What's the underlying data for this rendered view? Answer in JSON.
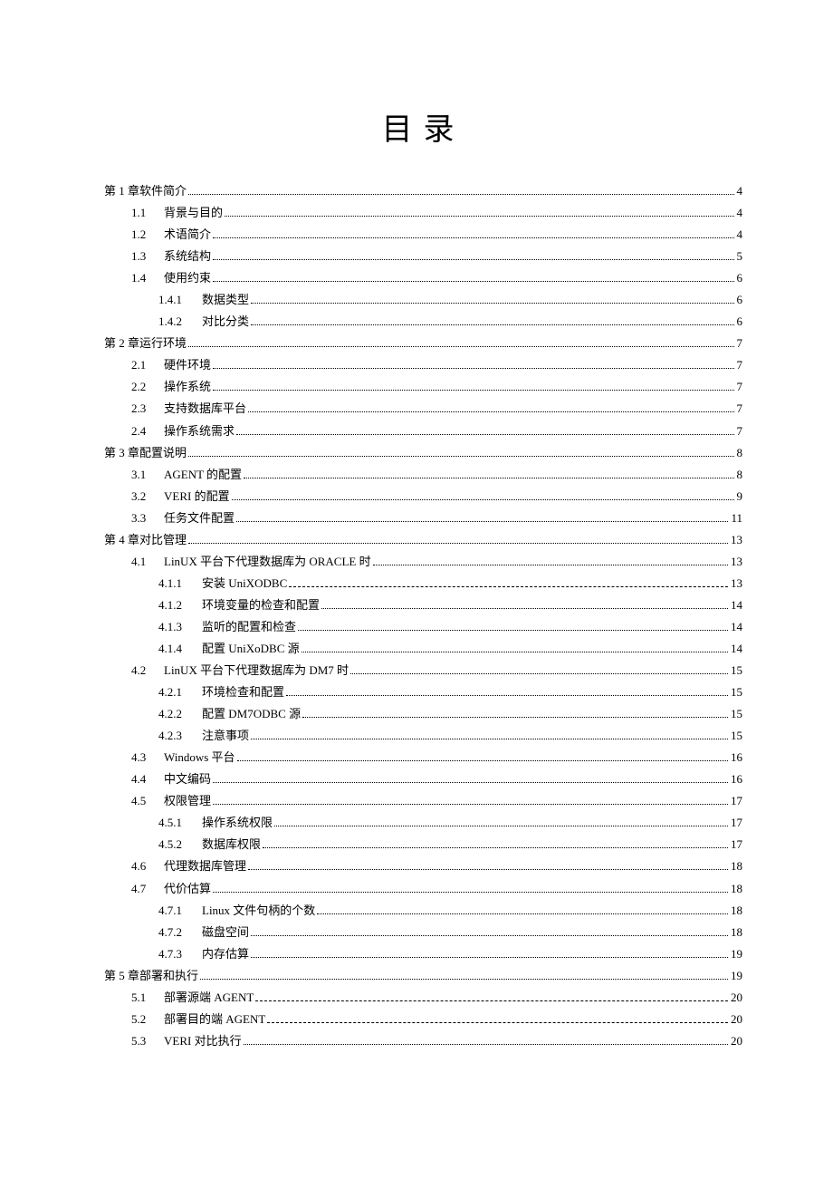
{
  "title": "目录",
  "entries": [
    {
      "level": 1,
      "num": "",
      "label": "第 1 章软件简介",
      "page": "4",
      "dash": false
    },
    {
      "level": 2,
      "num": "1.1",
      "label": "背景与目的",
      "page": "4",
      "dash": false
    },
    {
      "level": 2,
      "num": "1.2",
      "label": "术语简介",
      "page": "4",
      "dash": false
    },
    {
      "level": 2,
      "num": "1.3",
      "label": "系统结构",
      "page": "5",
      "dash": false
    },
    {
      "level": 2,
      "num": "1.4",
      "label": "使用约束",
      "page": "6",
      "dash": false
    },
    {
      "level": 3,
      "num": "1.4.1",
      "label": "数据类型",
      "page": "6",
      "dash": false
    },
    {
      "level": 3,
      "num": "1.4.2",
      "label": "对比分类",
      "page": "6",
      "dash": false
    },
    {
      "level": 1,
      "num": "",
      "label": "第 2 章运行环境",
      "page": "7",
      "dash": false
    },
    {
      "level": 2,
      "num": "2.1",
      "label": "硬件环境",
      "page": "7",
      "dash": false
    },
    {
      "level": 2,
      "num": "2.2",
      "label": "操作系统",
      "page": "7",
      "dash": false
    },
    {
      "level": 2,
      "num": "2.3",
      "label": "支持数据库平台",
      "page": "7",
      "dash": false
    },
    {
      "level": 2,
      "num": "2.4",
      "label": "操作系统需求",
      "page": "7",
      "dash": false
    },
    {
      "level": 1,
      "num": "",
      "label": "第 3 章配置说明",
      "page": "8",
      "dash": false
    },
    {
      "level": 2,
      "num": "3.1",
      "label": "AGENT 的配置",
      "page": "8",
      "dash": false
    },
    {
      "level": 2,
      "num": "3.2",
      "label": "VERI 的配置",
      "page": "9",
      "dash": false
    },
    {
      "level": 2,
      "num": "3.3",
      "label": "任务文件配置",
      "page": "11",
      "dash": false
    },
    {
      "level": 1,
      "num": "",
      "label": "第 4 章对比管理",
      "page": "13",
      "dash": false
    },
    {
      "level": 2,
      "num": "4.1",
      "label": "LinUX 平台下代理数据库为 ORACLE 时",
      "page": "13",
      "dash": false
    },
    {
      "level": 3,
      "num": "4.1.1",
      "label": "安装 UniXODBC",
      "page": "13",
      "dash": true
    },
    {
      "level": 3,
      "num": "4.1.2",
      "label": "环境变量的检查和配置",
      "page": "14",
      "dash": false
    },
    {
      "level": 3,
      "num": "4.1.3",
      "label": "监听的配置和检查",
      "page": "14",
      "dash": false
    },
    {
      "level": 3,
      "num": "4.1.4",
      "label": "配置 UniXoDBC 源",
      "page": "14",
      "dash": false
    },
    {
      "level": 2,
      "num": "4.2",
      "label": "LinUX 平台下代理数据库为 DM7 时",
      "page": "15",
      "dash": false
    },
    {
      "level": 3,
      "num": "4.2.1",
      "label": "环境检查和配置",
      "page": "15",
      "dash": false
    },
    {
      "level": 3,
      "num": "4.2.2",
      "label": "配置 DM7ODBC 源",
      "page": "15",
      "dash": false
    },
    {
      "level": 3,
      "num": "4.2.3",
      "label": "注意事项",
      "page": "15",
      "dash": false
    },
    {
      "level": 2,
      "num": "4.3",
      "label": "Windows 平台",
      "page": "16",
      "dash": false
    },
    {
      "level": 2,
      "num": "4.4",
      "label": "中文编码",
      "page": "16",
      "dash": false
    },
    {
      "level": 2,
      "num": "4.5",
      "label": "权限管理",
      "page": "17",
      "dash": false
    },
    {
      "level": 3,
      "num": "4.5.1",
      "label": "操作系统权限",
      "page": "17",
      "dash": false
    },
    {
      "level": 3,
      "num": "4.5.2",
      "label": "数据库权限",
      "page": "17",
      "dash": false
    },
    {
      "level": 2,
      "num": "4.6",
      "label": "代理数据库管理",
      "page": "18",
      "dash": false
    },
    {
      "level": 2,
      "num": "4.7",
      "label": "代价估算",
      "page": "18",
      "dash": false
    },
    {
      "level": 3,
      "num": "4.7.1",
      "label": "Linux 文件句柄的个数",
      "page": "18",
      "dash": false
    },
    {
      "level": 3,
      "num": "4.7.2",
      "label": "磁盘空间",
      "page": "18",
      "dash": false
    },
    {
      "level": 3,
      "num": "4.7.3",
      "label": "内存估算",
      "page": "19",
      "dash": false
    },
    {
      "level": 1,
      "num": "",
      "label": "第 5 章部署和执行",
      "page": "19",
      "dash": false
    },
    {
      "level": 2,
      "num": "5.1",
      "label": "部署源端 AGENT",
      "page": "20",
      "dash": true
    },
    {
      "level": 2,
      "num": "5.2",
      "label": "部署目的端 AGENT",
      "page": "20",
      "dash": true
    },
    {
      "level": 2,
      "num": "5.3",
      "label": "VERI 对比执行",
      "page": "20",
      "dash": false
    }
  ]
}
